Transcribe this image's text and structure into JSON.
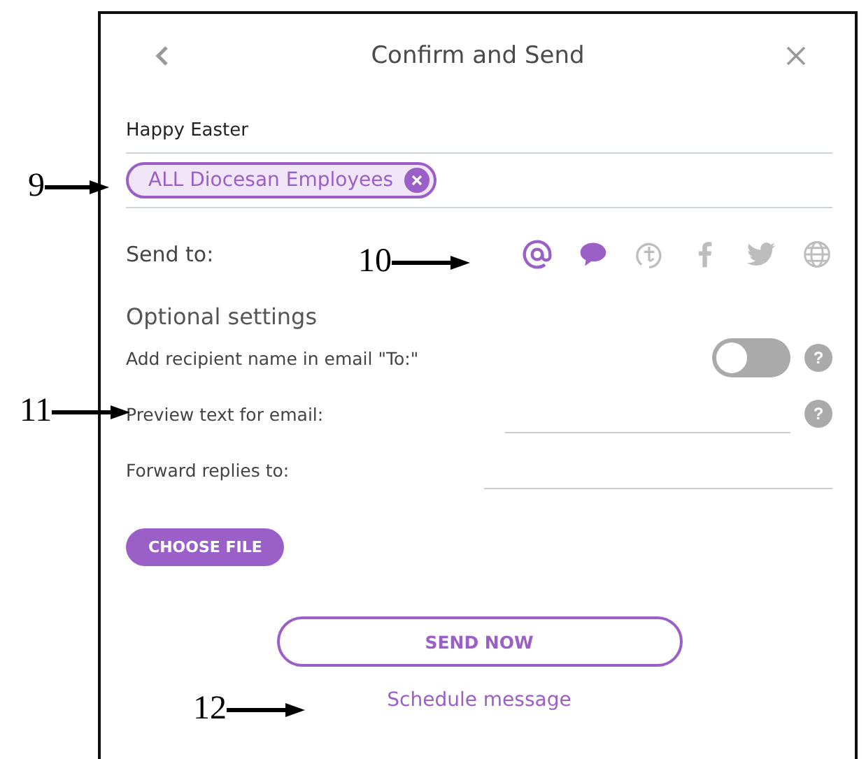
{
  "header": {
    "title": "Confirm and Send"
  },
  "subject": "Happy Easter",
  "recipients": [
    {
      "label": "ALL Diocesan Employees"
    }
  ],
  "send_to": {
    "label": "Send to:",
    "channels": [
      {
        "kind": "email",
        "selected": true
      },
      {
        "kind": "sms",
        "selected": true
      },
      {
        "kind": "app",
        "selected": false
      },
      {
        "kind": "facebook",
        "selected": false
      },
      {
        "kind": "twitter",
        "selected": false
      },
      {
        "kind": "web",
        "selected": false
      }
    ]
  },
  "optional_settings": {
    "title": "Optional settings",
    "rows": [
      {
        "kind": "toggle",
        "label": "Add recipient name in email \"To:\"",
        "on": false,
        "help": "?"
      },
      {
        "kind": "field",
        "label": "Preview text for email:",
        "help": "?"
      },
      {
        "kind": "field",
        "label": "Forward replies to:"
      }
    ]
  },
  "choose_file": "CHOOSE FILE",
  "send_now": "SEND NOW",
  "schedule": "Schedule message",
  "callouts": [
    {
      "label": "9"
    },
    {
      "label": "10"
    },
    {
      "label": "11"
    },
    {
      "label": "12"
    }
  ]
}
